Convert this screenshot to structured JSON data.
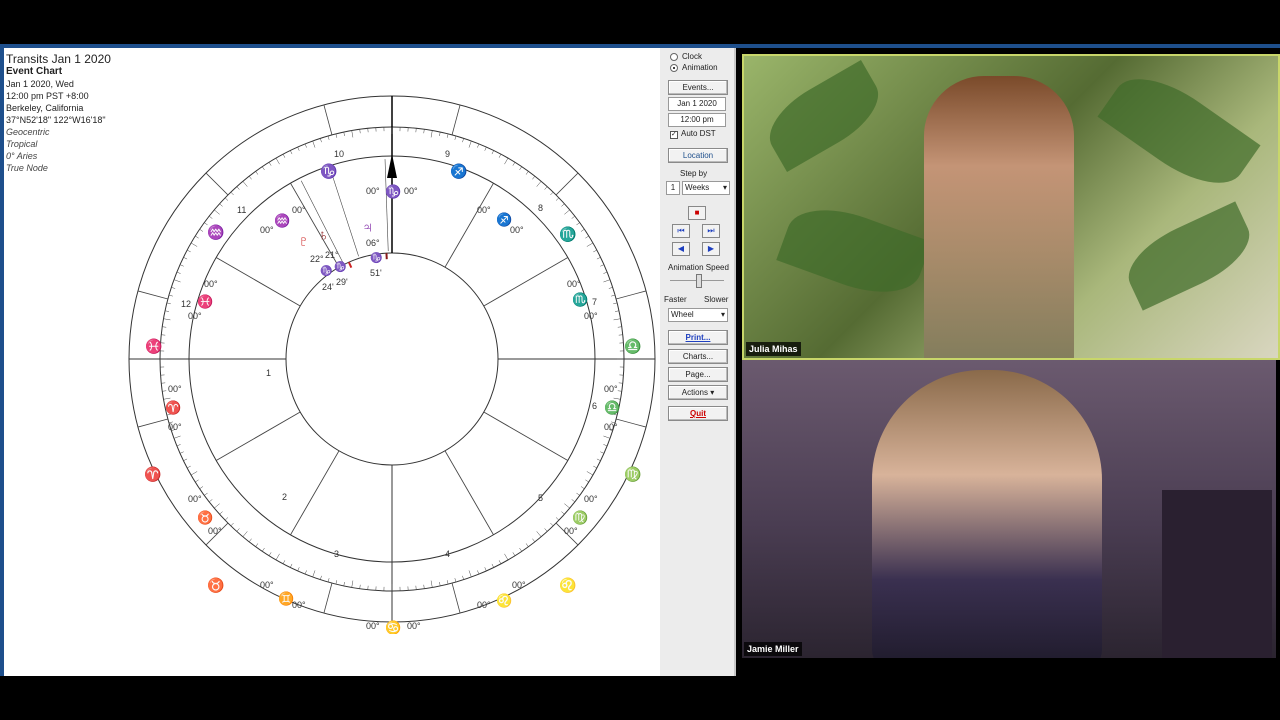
{
  "chart_info": {
    "title": "Transits Jan 1 2020",
    "chart_type": "Event Chart",
    "date": "Jan 1 2020, Wed",
    "time": "12:00 pm  PST +8:00",
    "place": "Berkeley, California",
    "coords": "37°N52'18\" 122°W16'18\"",
    "settings": [
      "Geocentric",
      "Tropical",
      "0° Aries",
      "True Node"
    ]
  },
  "wheel": {
    "house_numbers": [
      "1",
      "2",
      "3",
      "4",
      "5",
      "6",
      "7",
      "8",
      "9",
      "10",
      "11",
      "12"
    ],
    "cusp_degree": "00°",
    "planet_labels": {
      "pluto_deg": "22°",
      "pluto_min": "24'",
      "saturn_deg": "21°",
      "saturn_min": "29'",
      "jupiter_deg": "06°",
      "jupiter_min": "51'"
    }
  },
  "controls": {
    "radio_clock": "Clock",
    "radio_animation": "Animation",
    "events_btn": "Events...",
    "date_field": "Jan 1 2020",
    "time_field": "12:00 pm",
    "auto_dst": "Auto DST",
    "location_btn": "Location",
    "step_by": "Step by",
    "step_num": "1",
    "step_unit": "Weeks",
    "animation_speed": "Animation Speed",
    "faster": "Faster",
    "slower": "Slower",
    "wheel_select": "Wheel",
    "print_btn": "Print...",
    "charts_btn": "Charts...",
    "page_btn": "Page...",
    "actions_btn": "Actions",
    "quit_btn": "Quit"
  },
  "video": {
    "participant1": "Julia Mihas",
    "participant2": "Jamie Miller"
  },
  "colors": {
    "frame": "#1e4f8c",
    "speaker_highlight": "#c8d66a",
    "fire": "#cc2222",
    "earth": "#229922",
    "air": "#cc7a22",
    "water": "#2244cc"
  }
}
